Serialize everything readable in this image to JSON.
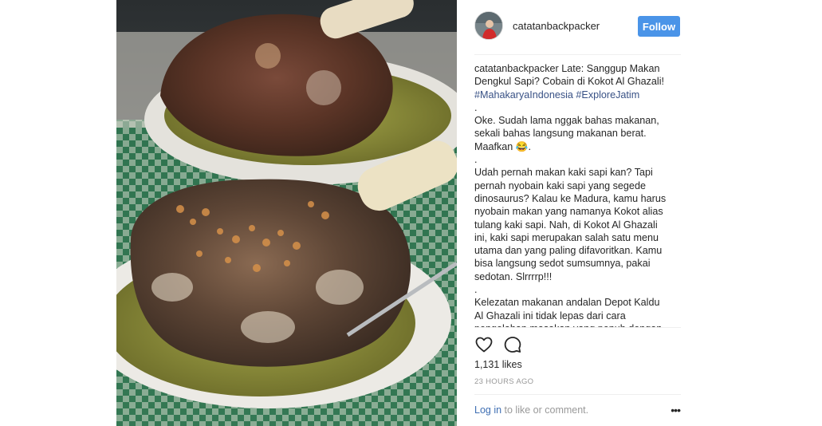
{
  "post": {
    "photo_icon": "food-photo",
    "username": "catatanbackpacker",
    "follow_label": "Follow",
    "caption": {
      "author": "catatanbackpacker",
      "title": "Late: Sanggup Makan Dengkul Sapi? Cobain di Kokot Al Ghazali!",
      "hashtags": [
        "#MahakaryaIndonesia",
        "#ExploreJatim"
      ],
      "dot1": ".",
      "para1": "Oke. Sudah lama nggak bahas makanan, sekali bahas langsung makanan berat. Maafkan 😂.",
      "dot2": ".",
      "para2": "Udah pernah makan kaki sapi kan? Tapi pernah nyobain kaki sapi yang segede dinosaurus? Kalau ke Madura, kamu harus nyobain makan yang namanya Kokot alias tulang kaki sapi. Nah, di Kokot Al Ghazali ini, kaki sapi merupakan salah satu menu utama dan yang paling difavoritkan. Kamu bisa langsung sedot sumsumnya, pakai sedotan. Slrrrrp!!!",
      "dot3": ".",
      "para3": "Kelezatan makanan andalan Depot Kaldu Al Ghazali ini tidak lepas dari cara pengolahan masakan yang penuh dengan"
    },
    "actions": {
      "like_icon": "heart-icon",
      "comment_icon": "comment-icon"
    },
    "likes": "1,131 likes",
    "time": "23 HOURS AGO",
    "login": {
      "link": "Log in",
      "text": " to like or comment."
    },
    "more_label": "•••"
  }
}
